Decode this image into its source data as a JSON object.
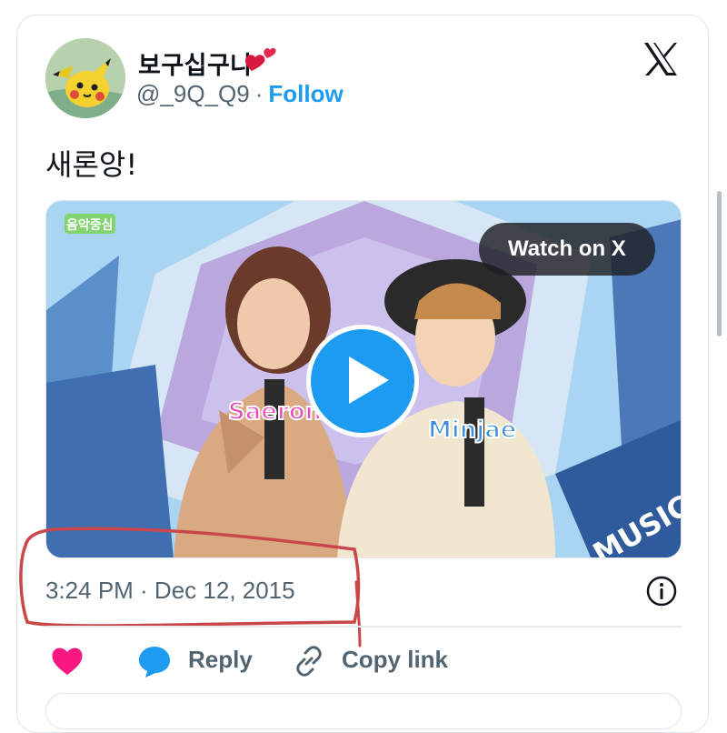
{
  "author": {
    "display_name": "보구십구나",
    "display_emoji_icon": "two-hearts-icon",
    "handle": "@_9Q_Q9",
    "separator": "·",
    "follow_label": "Follow",
    "avatar_icon": "pikachu-avatar"
  },
  "platform_logo": "x-logo-icon",
  "tweet": {
    "text": "새론앙!"
  },
  "media": {
    "watch_label": "Watch on X",
    "play_icon": "play-icon",
    "caption_left": "Saeron",
    "caption_right": "Minjae",
    "corner_text": "MUSIC C",
    "show_logo": "음악중심"
  },
  "meta": {
    "timestamp": "3:24 PM · Dec 12, 2015",
    "info_icon": "info-icon"
  },
  "actions": {
    "like_icon": "heart-icon",
    "reply_label": "Reply",
    "reply_icon": "speech-bubble-icon",
    "copy_label": "Copy link",
    "copy_icon": "link-icon"
  },
  "colors": {
    "accent": "#1d9bf0",
    "secondary_text": "#536471",
    "like": "#f91880",
    "annotation": "#c9474b"
  }
}
